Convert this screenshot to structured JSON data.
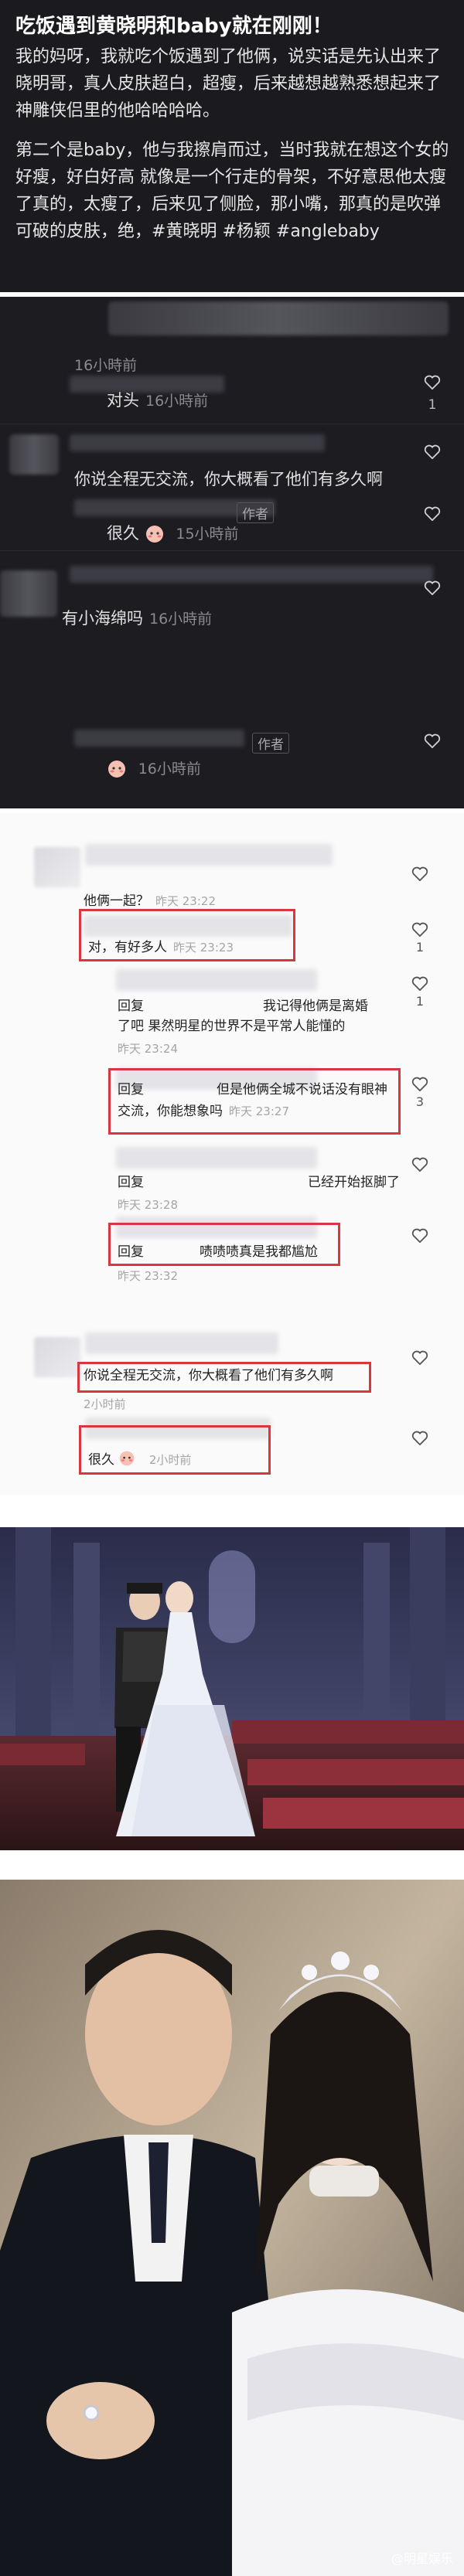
{
  "post": {
    "title": "吃饭遇到黄晓明和baby就在刚刚！",
    "para1": "我的妈呀，我就吃个饭遇到了他俩，说实话是先认出来了晓明哥，真人皮肤超白，超瘦，后来越想越熟悉想起来了神雕侠侣里的他哈哈哈哈。",
    "para2": "第二个是baby，他与我擦肩而过，当时我就在想这个女的好瘦，好白好高 就像是一个行走的骨架，不好意思他太瘦了真的，太瘦了，后来见了侧脸，那小嘴，那真的是吹弹可破的皮肤，绝，",
    "tags": [
      "#黄晓明",
      "#杨颖",
      "#anglebaby"
    ]
  },
  "dark_comments": [
    {
      "id": "c1",
      "text": "",
      "time": "16小時前",
      "likes": ""
    },
    {
      "id": "c2",
      "text": "对头",
      "time": "16小時前",
      "likes": "1"
    },
    {
      "id": "c3",
      "text": "你说全程无交流，你大概看了他们有多久啊",
      "time": "",
      "likes": ""
    },
    {
      "id": "c4",
      "text": "很久",
      "time": "15小時前",
      "likes": "",
      "author_tag": "作者"
    },
    {
      "id": "c5",
      "text": "有小海绵吗",
      "time": "16小時前",
      "likes": ""
    },
    {
      "id": "c6",
      "text": "",
      "time": "16小時前",
      "likes": "",
      "author_tag": "作者"
    }
  ],
  "light_comments": [
    {
      "id": "l1",
      "text": "他俩一起？",
      "time": "昨天 23:22"
    },
    {
      "id": "l2",
      "text": "对，有好多人",
      "time": "昨天 23:23",
      "likes": "1"
    },
    {
      "id": "l3a",
      "text": "回复",
      "text2": "我记得他俩是离婚",
      "line2": "了吧 果然明星的世界不是平常人能懂的",
      "time": "昨天 23:24",
      "likes": "1"
    },
    {
      "id": "l4",
      "text": "回复",
      "text2": "但是他俩全城不说话没有眼神",
      "line2": "交流，你能想象吗",
      "time": "昨天 23:27",
      "likes": "3"
    },
    {
      "id": "l5",
      "text": "回复",
      "text2": "已经开始抠脚了",
      "time": "昨天 23:28"
    },
    {
      "id": "l6",
      "text": "回复",
      "text2": "啧啧啧真是我都尴尬",
      "time": "昨天 23:32"
    },
    {
      "id": "l7",
      "text": "你说全程无交流，你大概看了他们有多久啊",
      "time": "2小时前"
    },
    {
      "id": "l8",
      "text": "很久",
      "time": "2小时前"
    }
  ],
  "photos": {
    "photo2_watermark": "@明星娱乐"
  },
  "colors": {
    "dark_bg": "#1b1b1f",
    "light_bg": "#fafafa",
    "highlight_box": "#d93640"
  }
}
